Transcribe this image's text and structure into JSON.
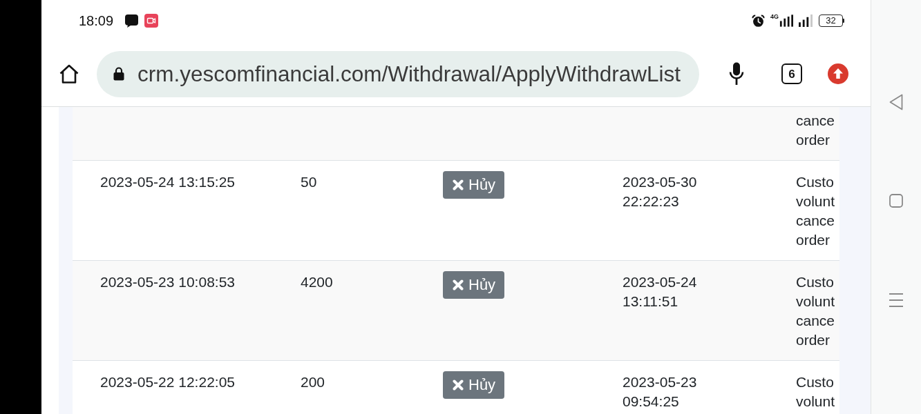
{
  "status_bar": {
    "time": "18:09",
    "network_type": "4G",
    "battery": "32"
  },
  "browser": {
    "url": "crm.yescomfinancial.com/Withdrawal/ApplyWithdrawList",
    "tab_count": "6"
  },
  "table": {
    "rows": [
      {
        "column_5": "cance order"
      },
      {
        "column_1": "2023-05-24 13:15:25",
        "column_2": "50",
        "column_3": {
          "button": "Hủy"
        },
        "column_4": "2023-05-30 22:22:23",
        "column_5": "Custo volunt cance order"
      },
      {
        "column_1": "2023-05-23 10:08:53",
        "column_2": "4200",
        "column_3": {
          "button": "Hủy"
        },
        "column_4": "2023-05-24 13:11:51",
        "column_5": "Custo volunt cance order"
      },
      {
        "column_1": "2023-05-22 12:22:05",
        "column_2": "200",
        "column_3": {
          "button": "Hủy"
        },
        "column_4": "2023-05-23 09:54:25",
        "column_5": "Custo volunt"
      }
    ]
  }
}
